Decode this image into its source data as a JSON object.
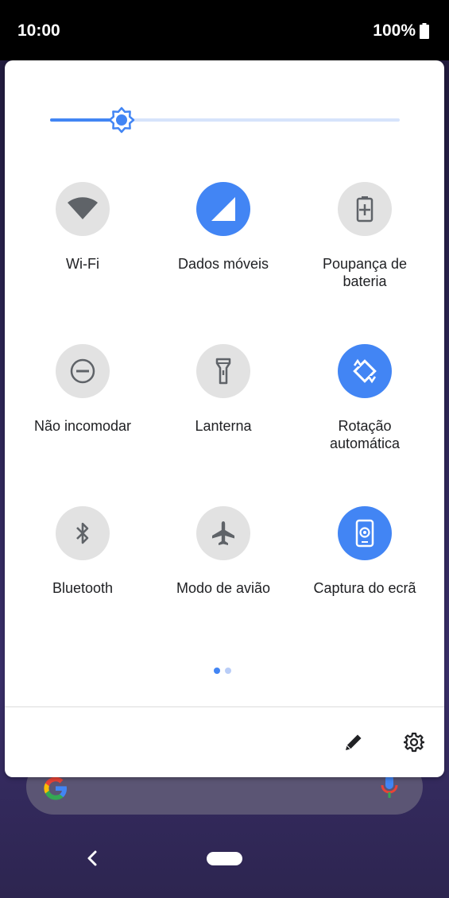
{
  "status": {
    "time": "10:00",
    "battery": "100%"
  },
  "tiles": [
    {
      "label": "Wi-Fi",
      "icon": "wifi-icon",
      "active": false
    },
    {
      "label": "Dados móveis",
      "icon": "signal-icon",
      "active": true
    },
    {
      "label": "Poupança de\nbateria",
      "icon": "battery-saver-icon",
      "active": false
    },
    {
      "label": "Não incomodar",
      "icon": "do-not-disturb-icon",
      "active": false
    },
    {
      "label": "Lanterna",
      "icon": "flashlight-icon",
      "active": false
    },
    {
      "label": "Rotação\nautomática",
      "icon": "auto-rotate-icon",
      "active": true
    },
    {
      "label": "Bluetooth",
      "icon": "bluetooth-icon",
      "active": false
    },
    {
      "label": "Modo de avião",
      "icon": "airplane-icon",
      "active": false
    },
    {
      "label": "Captura do ecrã",
      "icon": "screen-capture-icon",
      "active": true
    }
  ],
  "brightness": {
    "level": 0.2
  },
  "pager": {
    "pages": 2,
    "current": 1
  },
  "colors": {
    "accent": "#4285f4",
    "inactive_tile": "#e2e2e2"
  }
}
